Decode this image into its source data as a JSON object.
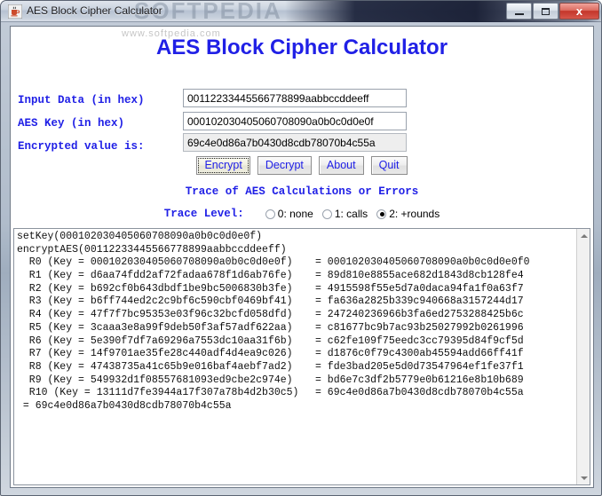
{
  "window": {
    "title": "AES Block Cipher Calculator",
    "icon": "java-coffee-cup-icon",
    "watermark_titlebar": "SOFTPEDIA",
    "watermark_body": "www.softpedia.com",
    "buttons": {
      "minimize": "minimize-button",
      "maximize": "maximize-button",
      "close_label": "x"
    }
  },
  "app": {
    "heading": "AES Block Cipher Calculator",
    "heading_color": "#2020e6"
  },
  "form": {
    "input_data_label": "Input Data (in hex)",
    "input_data_value": "00112233445566778899aabbccddeeff",
    "aes_key_label": "AES Key (in hex)",
    "aes_key_value": "000102030405060708090a0b0c0d0e0f",
    "encrypted_label": "Encrypted value is:",
    "encrypted_value": "69c4e0d86a7b0430d8cdb78070b4c55a"
  },
  "actions": {
    "encrypt": "Encrypt",
    "decrypt": "Decrypt",
    "about": "About",
    "quit": "Quit",
    "focused": "Encrypt"
  },
  "trace": {
    "heading": "Trace of AES Calculations or Errors",
    "level_label": "Trace Level:",
    "options": [
      {
        "label": "0: none",
        "selected": false
      },
      {
        "label": "1: calls",
        "selected": false
      },
      {
        "label": "2: +rounds",
        "selected": true
      }
    ],
    "lines": [
      {
        "left": "setKey(000102030405060708090a0b0c0d0e0f)",
        "right": ""
      },
      {
        "left": "encryptAES(00112233445566778899aabbccddeeff)",
        "right": ""
      },
      {
        "left": "  R0 (Key = 000102030405060708090a0b0c0d0e0f)",
        "right": "= 000102030405060708090a0b0c0d0e0f0"
      },
      {
        "left": "  R1 (Key = d6aa74fdd2af72fadaa678f1d6ab76fe)",
        "right": "= 89d810e8855ace682d1843d8cb128fe4"
      },
      {
        "left": "  R2 (Key = b692cf0b643dbdf1be9bc5006830b3fe)",
        "right": "= 4915598f55e5d7a0daca94fa1f0a63f7"
      },
      {
        "left": "  R3 (Key = b6ff744ed2c2c9bf6c590cbf0469bf41)",
        "right": "= fa636a2825b339c940668a3157244d17"
      },
      {
        "left": "  R4 (Key = 47f7f7bc95353e03f96c32bcfd058dfd)",
        "right": "= 247240236966b3fa6ed2753288425b6c"
      },
      {
        "left": "  R5 (Key = 3caaa3e8a99f9deb50f3af57adf622aa)",
        "right": "= c81677bc9b7ac93b25027992b0261996"
      },
      {
        "left": "  R6 (Key = 5e390f7df7a69296a7553dc10aa31f6b)",
        "right": "= c62fe109f75eedc3cc79395d84f9cf5d"
      },
      {
        "left": "  R7 (Key = 14f9701ae35fe28c440adf4d4ea9c026)",
        "right": "= d1876c0f79c4300ab45594add66ff41f"
      },
      {
        "left": "  R8 (Key = 47438735a41c65b9e016baf4aebf7ad2)",
        "right": "= fde3bad205e5d0d73547964ef1fe37f1"
      },
      {
        "left": "  R9 (Key = 549932d1f08557681093ed9cbe2c974e)",
        "right": "= bd6e7c3df2b5779e0b61216e8b10b689"
      },
      {
        "left": "  R10 (Key = 13111d7fe3944a17f307a78b4d2b30c5)",
        "right": "= 69c4e0d86a7b0430d8cdb78070b4c55a"
      },
      {
        "left": " = 69c4e0d86a7b0430d8cdb78070b4c55a",
        "right": ""
      }
    ]
  }
}
